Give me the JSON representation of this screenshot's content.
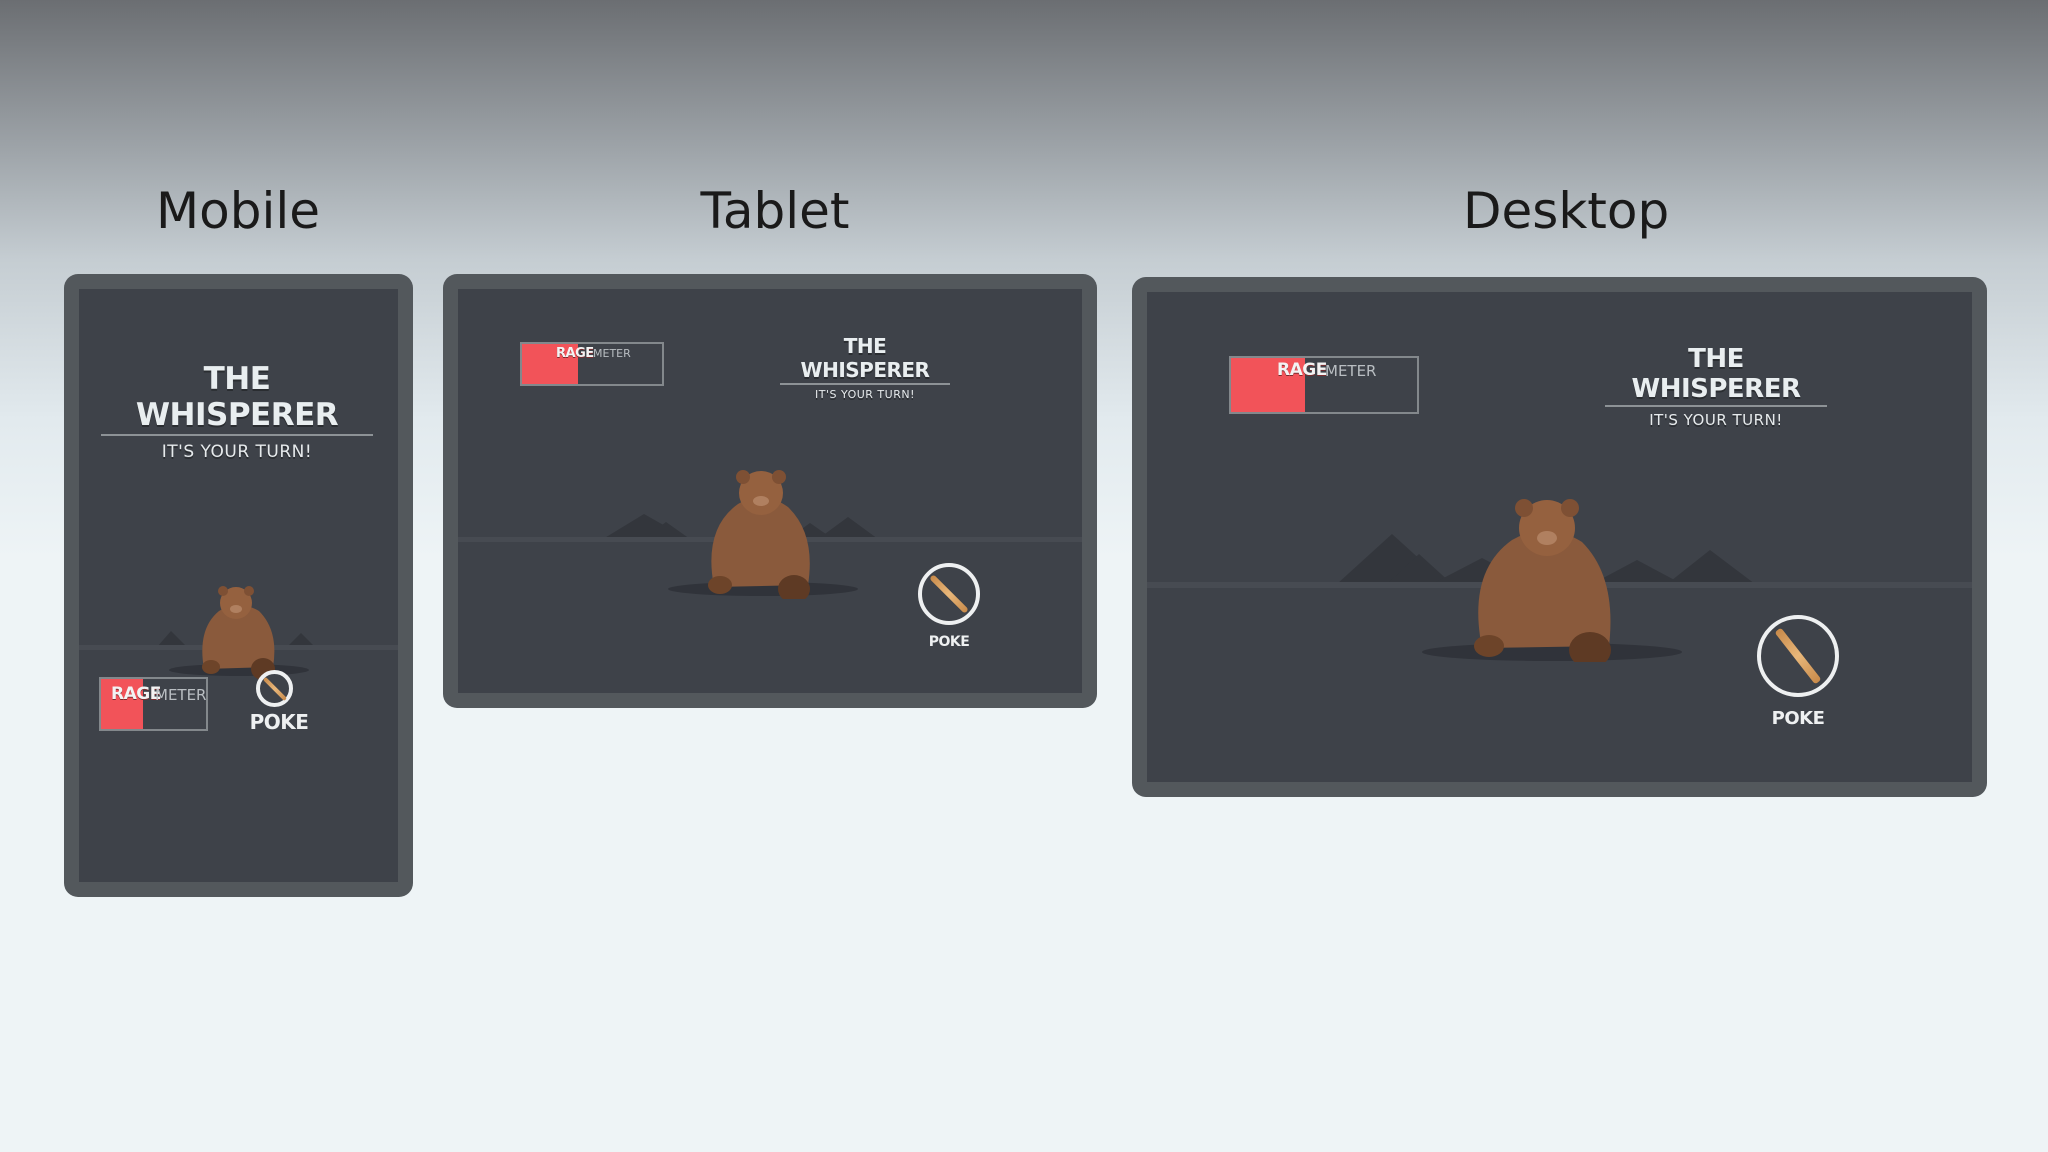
{
  "layouts": {
    "mobile": "Mobile",
    "tablet": "Tablet",
    "desktop": "Desktop"
  },
  "game": {
    "title": "THE WHISPERER",
    "subtitle": "IT'S YOUR TURN!",
    "rage_word": "RAGE",
    "meter_word": "METER",
    "poke_label": "POKE",
    "rage_level_fraction": 0.4
  },
  "colors": {
    "rage_fill": "#f25359",
    "screen_bg": "#3e4249",
    "device_frame": "#53585c",
    "mountains": "#33363c",
    "bear_fur": "#8a5a3c"
  },
  "icons": {
    "poke": "stick-icon",
    "character": "bear-icon"
  }
}
